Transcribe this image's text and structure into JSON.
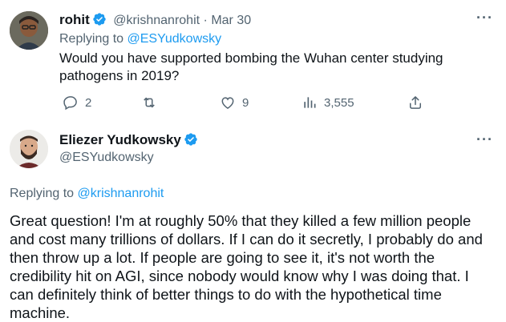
{
  "reply_tweet": {
    "author": {
      "name": "rohit",
      "handle": "@krishnanrohit",
      "date_sep": "·",
      "date": "Mar 30",
      "avatar_icon": "user-avatar"
    },
    "replying_to_prefix": "Replying to",
    "replying_to_handle": "@ESYudkowsky",
    "text_line1": "Would you have supported bombing the Wuhan center studying",
    "text_line2": "pathogens in 2019?",
    "actions": {
      "replies": "2",
      "retweets": "",
      "likes": "9",
      "views": "3,555"
    },
    "more_label": "···"
  },
  "main_tweet": {
    "author": {
      "name": "Eliezer Yudkowsky",
      "handle": "@ESYudkowsky",
      "avatar_icon": "user-avatar"
    },
    "replying_to_prefix": "Replying to",
    "replying_to_handle": "@krishnanrohit",
    "text_lines": [
      "Great question!  I'm at roughly 50% that they killed a few million people",
      "and cost many trillions of dollars.  If I can do it secretly, I probably do and",
      "then throw up a lot.  If people are going to see it, it's not worth the",
      "credibility hit on AGI, since nobody would know why I was doing that.  I",
      "can definitely think of better things to do with the hypothetical time",
      "machine."
    ],
    "more_label": "···"
  },
  "colors": {
    "link": "#1d9bf0",
    "muted": "#536471",
    "verified": "#1d9bf0",
    "text": "#0f1419"
  }
}
